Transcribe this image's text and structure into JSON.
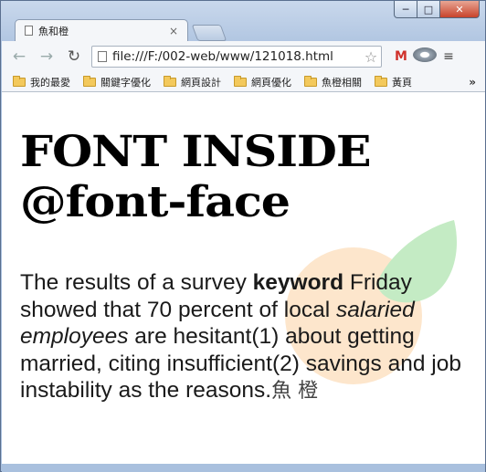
{
  "window": {
    "minimize_glyph": "─",
    "maximize_glyph": "□",
    "close_glyph": "✕"
  },
  "tab": {
    "title": "魚和橙",
    "close_glyph": "×"
  },
  "toolbar": {
    "back_glyph": "←",
    "forward_glyph": "→",
    "reload_glyph": "↻",
    "url": "file:///F:/002-web/www/121018.html",
    "star_glyph": "☆",
    "gmail_label": "M",
    "menu_glyph": "≡"
  },
  "bookmarks": {
    "items": [
      {
        "label": "我的最愛"
      },
      {
        "label": "關鍵字優化"
      },
      {
        "label": "網頁設計"
      },
      {
        "label": "網頁優化"
      },
      {
        "label": "魚橙相關"
      },
      {
        "label": "黃頁"
      }
    ],
    "more_glyph": "»"
  },
  "page": {
    "heading_line1": "FONT INSIDE",
    "heading_line2": "@font-face",
    "para_part1": "The results of a survey ",
    "para_bold": "keyword",
    "para_part2": " Friday showed that 70 percent of local ",
    "para_italic": "salaried employees",
    "para_part3": " are hesitant(1) about getting married, citing insufficient(2) savings and job instability as the reasons.",
    "para_cjk": "魚 橙"
  },
  "colors": {
    "logo_orange": "#fde6cc",
    "logo_leaf": "#c4ebc4",
    "gmail_red": "#d0322c"
  },
  "icons": [
    "page-icon",
    "close-icon",
    "back-icon",
    "forward-icon",
    "reload-icon",
    "document-icon",
    "star-icon",
    "gmail-icon",
    "extension-icon",
    "menu-icon",
    "folder-icon"
  ]
}
